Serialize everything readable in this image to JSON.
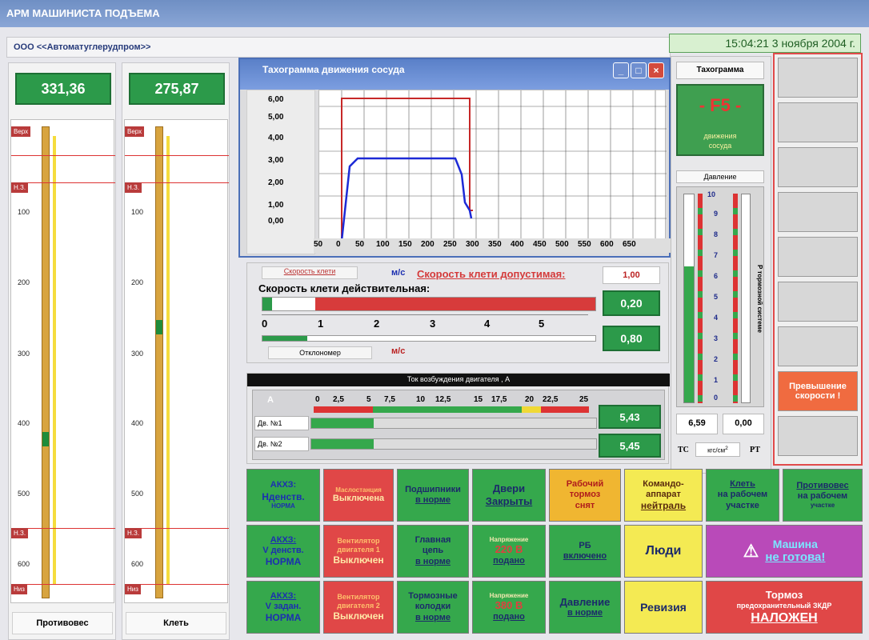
{
  "app": {
    "title": "АРМ МАШИНИСТА ПОДЪЕМА",
    "company": "ООО  <<Автоматуглерудпром>>",
    "datetime": "15:04:21 3 ноября 2004 г."
  },
  "left_panels": [
    {
      "value": "331,36",
      "label": "Противовес",
      "top_mark": "Верх",
      "nz1": "Н.З.",
      "nz2": "Н.З.",
      "bottom_mark": "Низ",
      "ticks": [
        "100",
        "200",
        "300",
        "400",
        "500",
        "600"
      ]
    },
    {
      "value": "275,87",
      "label": "Клеть",
      "top_mark": "Верх",
      "nz1": "Н.З.",
      "nz2": "Н.З.",
      "bottom_mark": "Низ",
      "ticks": [
        "100",
        "200",
        "300",
        "400",
        "500",
        "600"
      ]
    }
  ],
  "tacho_window": {
    "title": "Тахограмма движения сосуда",
    "y_ticks": [
      "6,00",
      "5,00",
      "4,00",
      "3,00",
      "2,00",
      "1,00",
      "0,00"
    ],
    "x_ticks": [
      "50",
      "0",
      "50",
      "100",
      "150",
      "200",
      "250",
      "300",
      "350",
      "400",
      "450",
      "500",
      "550",
      "600",
      "650"
    ]
  },
  "speed": {
    "speed_label": "Скорость клети",
    "unit": "м/с",
    "allowed_title": "Скорость клети допустимая:",
    "allowed_value": "1,00",
    "actual_title": "Скорость клети действительная:",
    "actual_value": "0,20",
    "scale": [
      "0",
      "1",
      "2",
      "3",
      "4",
      "5"
    ],
    "deviation_label": "Отклономер",
    "deviation_unit": "м/с",
    "deviation_value": "0,80"
  },
  "excitation": {
    "title": "Ток возбуждения двигателя , А",
    "unit": "А",
    "scale": [
      "0",
      "2,5",
      "5",
      "7,5",
      "10",
      "12,5",
      "15",
      "17,5",
      "20",
      "22,5",
      "25"
    ],
    "motor1": {
      "label": "Дв. №1",
      "value": "5,43"
    },
    "motor2": {
      "label": "Дв. №2",
      "value": "5,45"
    }
  },
  "status_rows": [
    [
      {
        "l1": "АКХЗ:",
        "l2": "Нденств.",
        "l3": "НОРМА",
        "c": "g"
      },
      {
        "l1": "Маслостанция",
        "l2": "Выключена",
        "l3": "",
        "c": "r"
      },
      {
        "l1": "Подшипники",
        "l2": "в норме",
        "l3": "",
        "c": "g"
      },
      {
        "l1": "Двери",
        "l2": "Закрыты",
        "l3": "",
        "c": "g"
      },
      {
        "l1": "Рабочий",
        "l2": "тормоз",
        "l3": "снят",
        "c": "y"
      },
      {
        "l1": "Командо-",
        "l2": "аппарат",
        "l3": "нейтраль",
        "c": "y"
      },
      {
        "l1": "Клеть",
        "l2": "на рабочем",
        "l3": "участке",
        "c": "g"
      },
      {
        "l1": "Противовес",
        "l2": "на рабочем",
        "l3": "участке",
        "c": "g"
      }
    ],
    [
      {
        "l1": "АКХЗ:",
        "l2": "V денств.",
        "l3": "НОРМА",
        "c": "g"
      },
      {
        "l1": "Вентилятор",
        "l2": "двигателя 1",
        "l3": "Выключен",
        "c": "r"
      },
      {
        "l1": "Главная",
        "l2": "цепь",
        "l3": "в норме",
        "c": "g"
      },
      {
        "l1": "Напряжение",
        "l2": "220 В",
        "l3": "подано",
        "c": "g"
      },
      {
        "l1": "РБ",
        "l2": "включено",
        "l3": "",
        "c": "g"
      },
      {
        "l1": "Люди",
        "l2": "",
        "l3": "",
        "c": "y"
      },
      {
        "l1": "Машина",
        "l2": "не готова!",
        "l3": "",
        "c": "m"
      }
    ],
    [
      {
        "l1": "АКХЗ:",
        "l2": "V задан.",
        "l3": "НОРМА",
        "c": "g"
      },
      {
        "l1": "Вентилятор",
        "l2": "двигателя 2",
        "l3": "Выключен",
        "c": "r"
      },
      {
        "l1": "Тормозные",
        "l2": "колодки",
        "l3": "в норме",
        "c": "g"
      },
      {
        "l1": "Напряжение",
        "l2": "380 В",
        "l3": "подано",
        "c": "g"
      },
      {
        "l1": "Давление",
        "l2": "в норме",
        "l3": "",
        "c": "g"
      },
      {
        "l1": "Ревизия",
        "l2": "",
        "l3": "",
        "c": "y"
      },
      {
        "l1": "Тормоз",
        "l2": "предохранительный ЗКДР",
        "l3": "НАЛОЖЕН",
        "c": "r"
      }
    ]
  ],
  "right_panel": {
    "tacho_label": "Тахограмма",
    "code": "- F5 -",
    "code_note_1": "движения",
    "code_note_2": "сосуда",
    "pressure_title": "Давление",
    "pressure_side": "Р тормозной системе",
    "pressure_scale": [
      "10",
      "9",
      "8",
      "7",
      "6",
      "5",
      "4",
      "3",
      "2",
      "1",
      "0"
    ],
    "tc_value": "6,59",
    "pt_value": "0,00",
    "tc": "ТС",
    "pt": "РТ",
    "unit": "кгс/см",
    "sup": "2",
    "overspeed": "Превышение скорости !"
  }
}
